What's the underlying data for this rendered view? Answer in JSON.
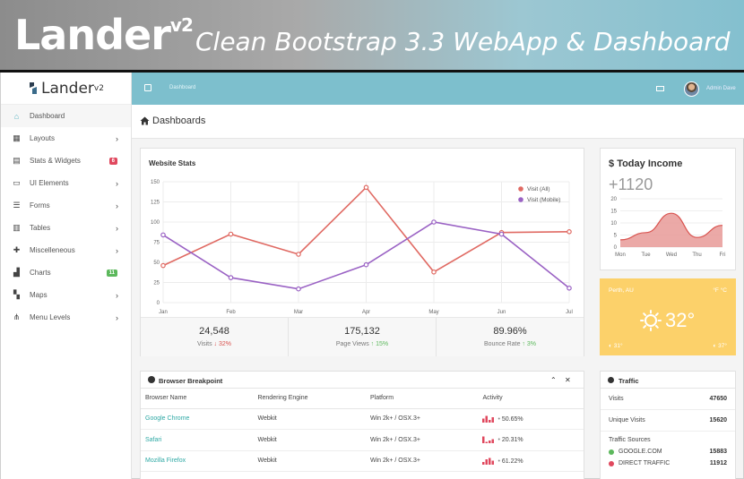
{
  "banner": {
    "logo": "Lander",
    "logo_sup": "v2",
    "tagline": "Clean Bootstrap 3.3 WebApp & Dashboard"
  },
  "brand": {
    "name": "Lander",
    "sup": "v2"
  },
  "sidebar": {
    "items": [
      {
        "label": "Dashboard",
        "icon": "home-icon",
        "chevron": false,
        "active": true
      },
      {
        "label": "Layouts",
        "icon": "grid-icon",
        "chevron": true
      },
      {
        "label": "Stats & Widgets",
        "icon": "widgets-icon",
        "badge": "6",
        "badge_color": "#e0485e"
      },
      {
        "label": "UI Elements",
        "icon": "monitor-icon",
        "chevron": true
      },
      {
        "label": "Forms",
        "icon": "form-icon",
        "chevron": true
      },
      {
        "label": "Tables",
        "icon": "table-icon",
        "chevron": true
      },
      {
        "label": "Miscelleneous",
        "icon": "puzzle-icon",
        "chevron": true
      },
      {
        "label": "Charts",
        "icon": "chart-icon",
        "badge": "11",
        "badge_color": "#5cb85c"
      },
      {
        "label": "Maps",
        "icon": "map-icon",
        "chevron": true
      },
      {
        "label": "Menu Levels",
        "icon": "sitemap-icon",
        "chevron": true
      }
    ]
  },
  "topbar": {
    "breadcrumb": "Dashboard",
    "user_name": "Admin Dave"
  },
  "page": {
    "title": "Dashboards"
  },
  "website_stats": {
    "title": "Website Stats",
    "legend": [
      "Visit (All)",
      "Visit (Mobile)"
    ],
    "summary": [
      {
        "value": "24,548",
        "label": "Visits",
        "change": "32%",
        "dir": "down"
      },
      {
        "value": "175,132",
        "label": "Page Views",
        "change": "15%",
        "dir": "up"
      },
      {
        "value": "89.96%",
        "label": "Bounce Rate",
        "change": "3%",
        "dir": "up"
      }
    ]
  },
  "chart_data": [
    {
      "type": "line",
      "title": "Website Stats",
      "categories": [
        "Jan",
        "Feb",
        "Mar",
        "Apr",
        "May",
        "Jun",
        "Jul"
      ],
      "series": [
        {
          "name": "Visit (All)",
          "color": "#e06a63",
          "values": [
            46,
            85,
            60,
            143,
            38,
            87,
            88
          ]
        },
        {
          "name": "Visit (Mobile)",
          "color": "#9a62c4",
          "values": [
            84,
            31,
            17,
            47,
            100,
            85,
            18
          ]
        }
      ],
      "yticks": [
        0,
        25,
        50,
        75,
        100,
        125,
        150
      ],
      "ylim": [
        0,
        150
      ],
      "grid": true,
      "legend_position": "top-right"
    },
    {
      "type": "area",
      "title": "Today Income",
      "categories": [
        "Mon",
        "Tue",
        "Wed",
        "Thu",
        "Fri"
      ],
      "series": [
        {
          "values": [
            3,
            6,
            14,
            4,
            9
          ],
          "color": "#e89a98"
        }
      ],
      "yticks": [
        0,
        5,
        10,
        15,
        20
      ],
      "ylim": [
        0,
        20
      ],
      "grid": true
    }
  ],
  "income": {
    "title": "Today Income",
    "currency": "$",
    "amount": "+1120"
  },
  "weather": {
    "location": "Perth, AU",
    "unit": "°F  °C",
    "temp": "32°",
    "low": "31°",
    "high": "37°"
  },
  "browser": {
    "title": "Browser Breakpoint",
    "columns": [
      "Browser Name",
      "Rendering Engine",
      "Platform",
      "Activity"
    ],
    "rows": [
      {
        "name": "Google Chrome",
        "engine": "Webkit",
        "platform": "Win 2k+ / OSX.3+",
        "activity": "50.65%",
        "bars": [
          3,
          5,
          2,
          4
        ]
      },
      {
        "name": "Safari",
        "engine": "Webkit",
        "platform": "Win 2k+ / OSX.3+",
        "activity": "20.31%",
        "bars": [
          5,
          1,
          2,
          3
        ]
      },
      {
        "name": "Mozilla Firefox",
        "engine": "Webkit",
        "platform": "Win 2k+ / OSX.3+",
        "activity": "61.22%",
        "bars": [
          2,
          4,
          5,
          3
        ]
      }
    ]
  },
  "traffic": {
    "title": "Traffic",
    "visits_label": "Visits",
    "visits": "47650",
    "unique_label": "Unique Visits",
    "unique": "15620",
    "sources_label": "Traffic Sources",
    "sources": [
      {
        "name": "GOOGLE.COM",
        "value": "15883",
        "color": "#5cb85c"
      },
      {
        "name": "DIRECT TRAFFIC",
        "value": "11912",
        "color": "#e0485e"
      }
    ]
  },
  "colors": {
    "accent": "#7dbfcd",
    "teal": "#2fa9a5",
    "all": "#e06a63",
    "mobile": "#9a62c4"
  }
}
